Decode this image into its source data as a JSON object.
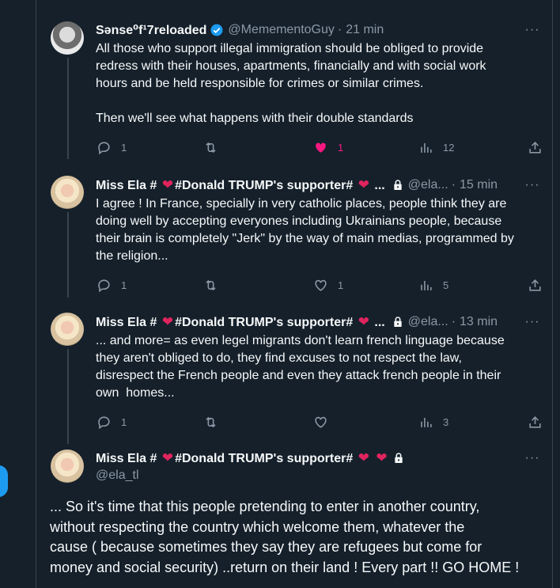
{
  "tweets": [
    {
      "name": "Sənse⁰f¹7reloaded",
      "handle": "@MemementoGuy",
      "dot": "·",
      "time": "21 min",
      "text_lines": [
        "All those who support illegal immigration should be obliged to provide",
        "redress with their houses, apartments, financially and with social work",
        "hours and be held responsible for crimes or similar crimes.",
        "",
        "Then we'll see what happens with their double standards"
      ],
      "replies": "1",
      "retweets": "",
      "likes": "1",
      "views": "12"
    },
    {
      "name_prefix": "Miss Ela #",
      "name_suffix": "#Donald TRUMP's supporter#",
      "name_ellipsis": "...",
      "handle": "@ela...",
      "dot": "·",
      "time": "15 min",
      "text_lines": [
        "I agree ! In France, specially in very catholic places, people think they are",
        "doing well by accepting everyones including Ukrainians people, because",
        "their brain is completely \"Jerk\" by the way of main medias, programmed by",
        "the religion..."
      ],
      "replies": "1",
      "likes": "1",
      "views": "5"
    },
    {
      "name_prefix": "Miss Ela #",
      "name_suffix": "#Donald TRUMP's supporter#",
      "name_ellipsis": "...",
      "handle": "@ela...",
      "dot": "·",
      "time": "13 min",
      "text_lines": [
        "... and more= as even legel migrants don't learn french linguage because",
        "they aren't obliged to do, they find excuses to not respect the law,",
        "disrespect the French people and even they attack french people in their",
        "own  homes..."
      ],
      "replies": "1",
      "likes": "",
      "views": "3"
    },
    {
      "name_prefix": "Miss Ela #",
      "name_suffix": "#Donald TRUMP's supporter#",
      "handle": "@ela_tl",
      "text_lines": [
        "... So it's time that this people pretending to enter in another country,",
        "without respecting the country which welcome them, whatever the",
        "cause ( because sometimes they say they are refugees but come for",
        "money and social security) ..return on their land ! Every part !! GO HOME !"
      ]
    }
  ],
  "ui": {
    "more": "···",
    "heart": "❤"
  },
  "colors": {
    "background": "#15202b",
    "accent": "#1d9bf0",
    "like": "#f91880",
    "muted": "#8b98a5"
  },
  "icons": [
    "reply-icon",
    "retweet-icon",
    "like-icon",
    "views-icon",
    "share-icon",
    "verified-icon",
    "lock-icon",
    "more-icon"
  ]
}
